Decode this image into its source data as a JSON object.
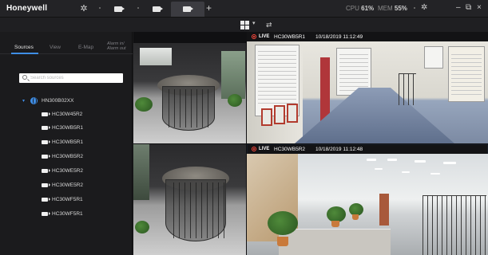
{
  "app": {
    "brand": "Honeywell"
  },
  "top_bar": {
    "gear_icon": "gear-icon",
    "tabs": [
      {
        "icon": "camera-icon",
        "active": false
      },
      {
        "icon": "camera-icon",
        "active": false
      },
      {
        "icon": "camera-icon",
        "active": true
      }
    ],
    "add_tab_label": "+",
    "stats": [
      {
        "label": "CPU",
        "value": "61%"
      },
      {
        "label": "MEM",
        "value": "55%"
      }
    ],
    "right_icons": [
      "settings-icon",
      "minimize-icon",
      "restore-icon",
      "close-icon"
    ]
  },
  "layout_toolbar": {
    "layout_icon": "grid-layout-icon",
    "layout_caret": "▾",
    "sequence_icon": "sequence-icon"
  },
  "sidebar": {
    "tabs": [
      {
        "label": "Sources",
        "active": true
      },
      {
        "label": "View",
        "active": false
      },
      {
        "label": "E-Map",
        "active": false
      },
      {
        "label": "Alarm in/ Alarm out",
        "active": false
      }
    ],
    "search": {
      "placeholder": "Search sources",
      "value": ""
    },
    "tree": {
      "root": {
        "label": "HN300B02XX",
        "expanded": true
      },
      "cameras": [
        "HC30W45R2",
        "HC30WB5R1",
        "HC30WB5R1",
        "HC30WB5R2",
        "HC30WE5R2",
        "HC30WE5R2",
        "HC30WF5R1",
        "HC30WF5R1"
      ]
    }
  },
  "video_tiles": [
    {
      "id": "tile-1",
      "live": false,
      "camera": "",
      "timestamp": ""
    },
    {
      "id": "tile-2",
      "live": true,
      "live_label": "LIVE",
      "camera": "HC30WB5R1",
      "timestamp": "10/18/2019 11:12:49"
    },
    {
      "id": "tile-3",
      "live": false,
      "camera": "",
      "timestamp": ""
    },
    {
      "id": "tile-4",
      "live": true,
      "live_label": "LIVE",
      "camera": "HC30WB5R2",
      "timestamp": "10/18/2019 11:12:48"
    }
  ],
  "colors": {
    "accent": "#3f8ee6",
    "live": "#ff4a3d",
    "background": "#1b1b1d"
  }
}
